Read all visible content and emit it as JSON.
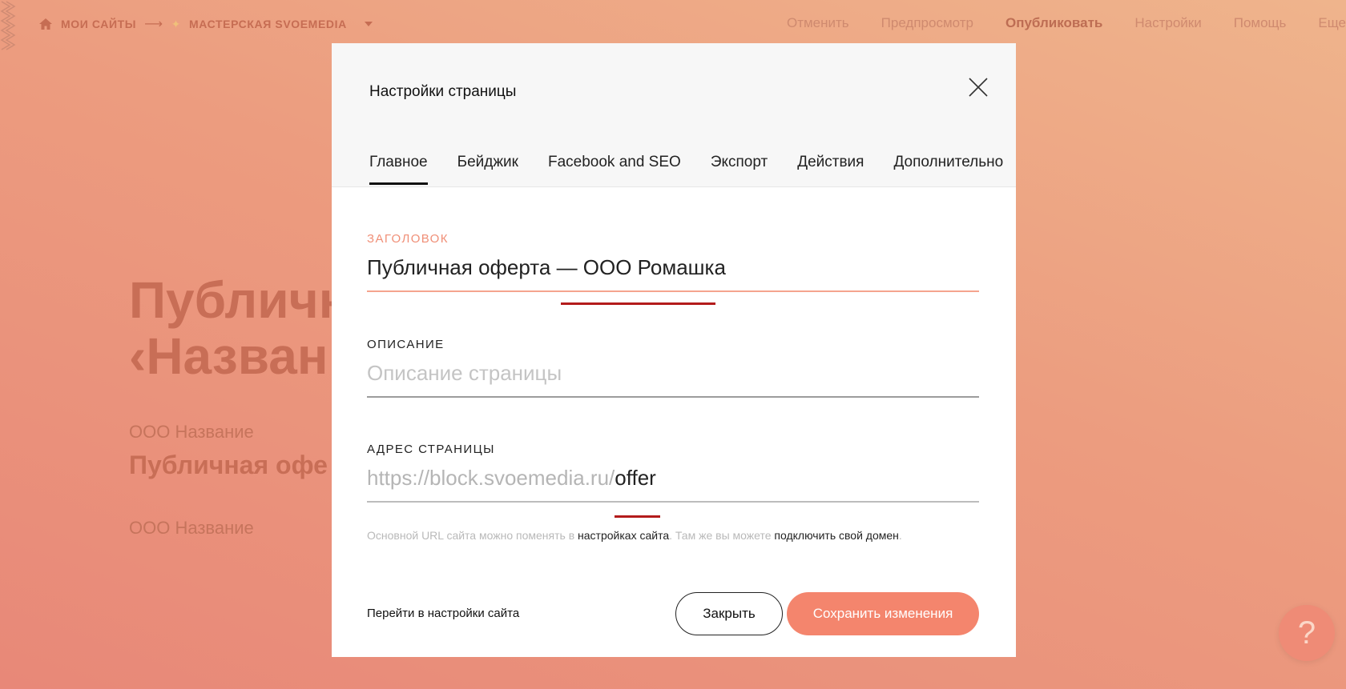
{
  "topbar": {
    "breadcrumb": {
      "my_sites": "МОИ САЙТЫ",
      "arrow": "⟶",
      "star": "✦",
      "site_name": "МАСТЕРСКАЯ SVOEMEDIA"
    },
    "nav": {
      "cancel": "Отменить",
      "preview": "Предпросмотр",
      "publish": "Опубликовать",
      "settings": "Настройки",
      "help": "Помощь",
      "more": "Еще"
    }
  },
  "background": {
    "heading_line1": "Публичн",
    "heading_line2": "‹Назван",
    "sub1": "ООО Название",
    "sub2": "Публичная офе",
    "sub3": "ООО Название"
  },
  "modal": {
    "title": "Настройки страницы",
    "tabs": [
      {
        "label": "Главное",
        "active": true
      },
      {
        "label": "Бейджик",
        "active": false
      },
      {
        "label": "Facebook and SEO",
        "active": false
      },
      {
        "label": "Экспорт",
        "active": false
      },
      {
        "label": "Действия",
        "active": false
      },
      {
        "label": "Дополнительно",
        "active": false
      }
    ],
    "title_field": {
      "label": "ЗАГОЛОВОК",
      "value": "Публичная оферта — ООО Ромашка"
    },
    "description_field": {
      "label": "ОПИСАНИЕ",
      "placeholder": "Описание страницы"
    },
    "address_field": {
      "label": "АДРЕС СТРАНИЦЫ",
      "prefix": "https://block.svoemedia.ru/",
      "value": "offer"
    },
    "hint": {
      "part1": "Основной URL сайта можно поменять в ",
      "link1": "настройках сайта",
      "part2": ". Там же вы можете ",
      "link2": "подключить свой домен",
      "part3": "."
    },
    "footer": {
      "go_to_settings": "Перейти в настройки сайта",
      "close_button": "Закрыть",
      "save_button": "Сохранить изменения"
    }
  },
  "help_bubble": {
    "symbol": "?"
  },
  "colors": {
    "accent": "#f4856d",
    "annotation_red": "#b31b1b",
    "label_accent": "#f08f77"
  }
}
